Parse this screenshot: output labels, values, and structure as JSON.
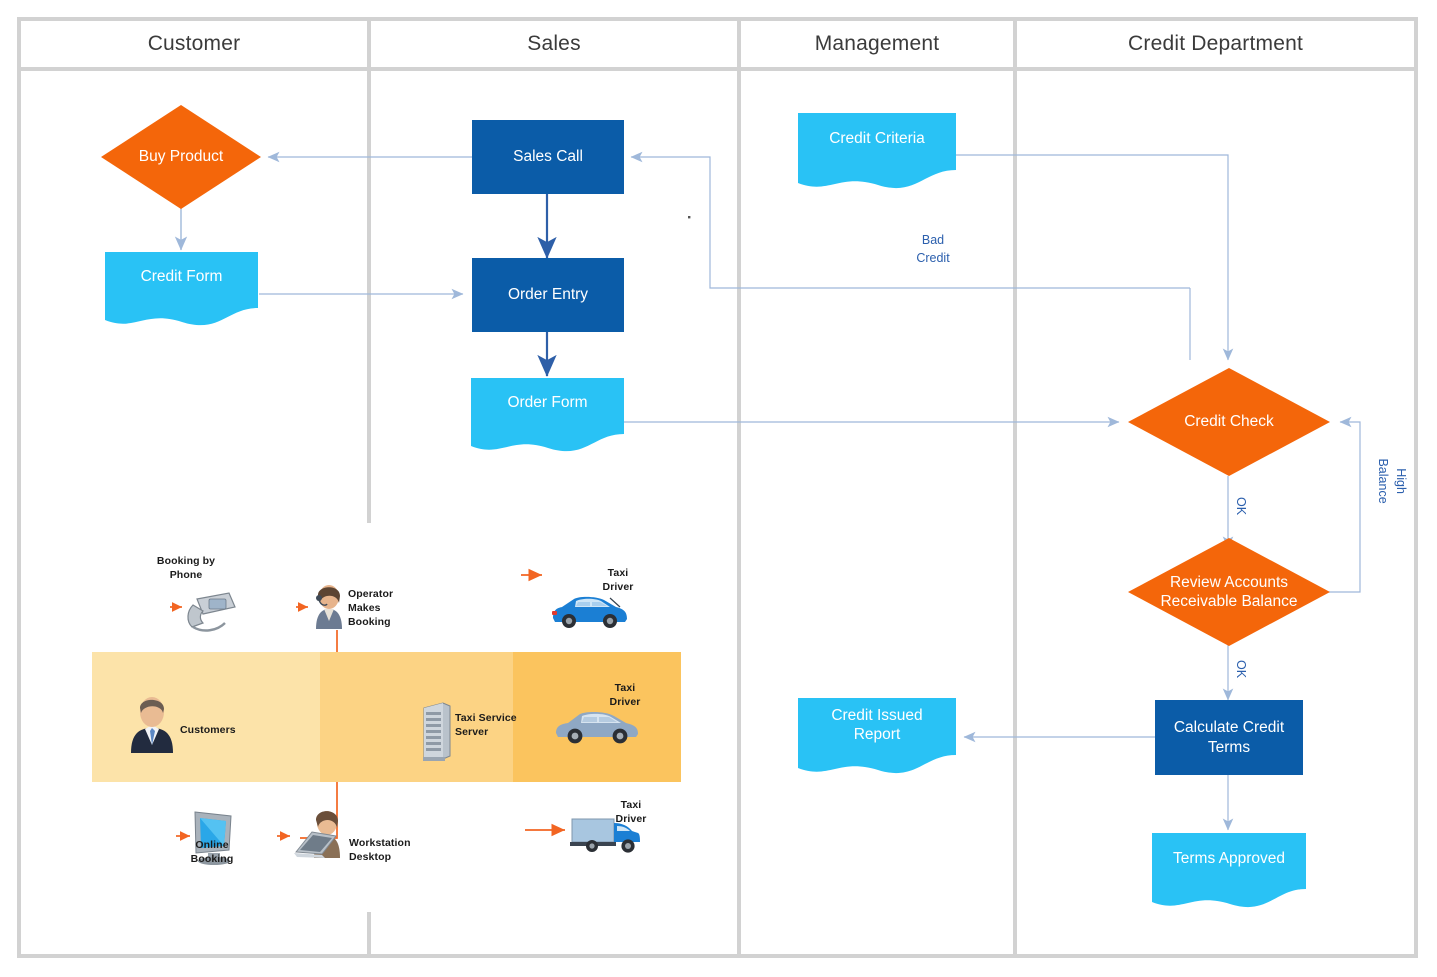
{
  "diagram": {
    "title": "Credit Approval Swimlane Flowchart",
    "colors": {
      "process_blue": "#0B5CA8",
      "document_cyan": "#29C2F5",
      "decision_orange": "#F4660A",
      "connector_blue": "#9FB8DA",
      "label_blue": "#2B5FAD",
      "lane_border": "#D2D2D2",
      "band_light": "#FCE3A9",
      "band_mid": "#FCD384",
      "band_dark": "#FBC45E",
      "arrow_orange": "#F26522"
    },
    "lanes": [
      {
        "id": "customer",
        "label": "Customer"
      },
      {
        "id": "sales",
        "label": "Sales"
      },
      {
        "id": "management",
        "label": "Management"
      },
      {
        "id": "credit",
        "label": "Credit Department"
      }
    ],
    "nodes": [
      {
        "id": "buy-product",
        "label": "Buy Product",
        "shape": "decision",
        "lane": "customer"
      },
      {
        "id": "credit-form",
        "label": "Credit Form",
        "shape": "document",
        "lane": "customer"
      },
      {
        "id": "sales-call",
        "label": "Sales Call",
        "shape": "process",
        "lane": "sales"
      },
      {
        "id": "order-entry",
        "label": "Order Entry",
        "shape": "process",
        "lane": "sales"
      },
      {
        "id": "order-form",
        "label": "Order Form",
        "shape": "document",
        "lane": "sales"
      },
      {
        "id": "credit-criteria",
        "label": "Credit Criteria",
        "shape": "document",
        "lane": "management"
      },
      {
        "id": "credit-issued-report",
        "label": "Credit Issued\nReport",
        "line1": "Credit Issued",
        "line2": "Report",
        "shape": "document",
        "lane": "management"
      },
      {
        "id": "credit-check",
        "label": "Credit Check",
        "shape": "decision",
        "lane": "credit"
      },
      {
        "id": "review-accounts",
        "line1": "Review Accounts",
        "line2": "Receivable Balance",
        "shape": "decision",
        "lane": "credit"
      },
      {
        "id": "calculate-credit-terms",
        "line1": "Calculate Credit",
        "line2": "Terms",
        "shape": "process",
        "lane": "credit"
      },
      {
        "id": "terms-approved",
        "label": "Terms Approved",
        "shape": "document",
        "lane": "credit"
      }
    ],
    "edge_labels": {
      "bad_credit_l1": "Bad",
      "bad_credit_l2": "Credit",
      "ok_1": "OK",
      "ok_2": "OK",
      "high_balance_l1": "High",
      "high_balance_l2": "Balance"
    }
  },
  "subdiagram": {
    "name": "taxi-booking-system",
    "labels": {
      "booking_by_phone_l1": "Booking by",
      "booking_by_phone_l2": "Phone",
      "operator_l1": "Operator",
      "operator_l2": "Makes",
      "operator_l3": "Booking",
      "taxi_driver_top_l1": "Taxi",
      "taxi_driver_top_l2": "Driver",
      "customers": "Customers",
      "taxi_service_server_l1": "Taxi Service",
      "taxi_service_server_l2": "Server",
      "taxi_driver_mid_l1": "Taxi",
      "taxi_driver_mid_l2": "Driver",
      "online_booking_l1": "Online",
      "online_booking_l2": "Booking",
      "workstation_l1": "Workstation",
      "workstation_l2": "Desktop",
      "taxi_driver_bot_l1": "Taxi",
      "taxi_driver_bot_l2": "Driver"
    },
    "icons": [
      {
        "name": "desk-phone-icon"
      },
      {
        "name": "operator-headset-person-icon"
      },
      {
        "name": "blue-hatchback-taxi-icon"
      },
      {
        "name": "customer-person-icon"
      },
      {
        "name": "server-rack-icon"
      },
      {
        "name": "blue-sedan-taxi-icon"
      },
      {
        "name": "crt-monitor-icon"
      },
      {
        "name": "laptop-person-icon"
      },
      {
        "name": "blue-van-truck-icon"
      }
    ]
  }
}
